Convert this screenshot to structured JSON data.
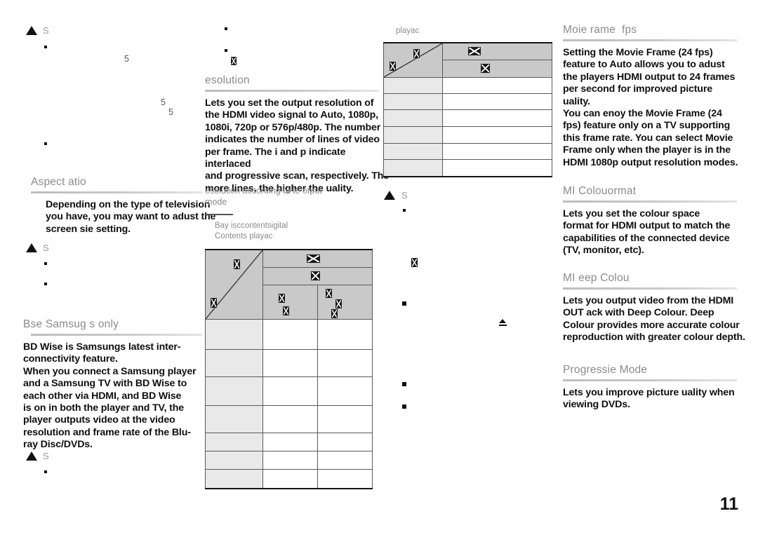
{
  "document": {
    "type": "product-manual-page",
    "page_number": "11",
    "note_label": "S",
    "missing_glyph": " "
  },
  "columns": {
    "col1": {
      "note_top": {
        "label": "S"
      },
      "stray_digits": [
        "5",
        "5",
        "5"
      ],
      "sections": [
        {
          "heading": "Aspect atio",
          "body": "Depending on the type of television\nyou have, you may want to adust the\nscreen sie setting.",
          "note_label": "S",
          "note_bullets": [
            "",
            ""
          ]
        },
        {
          "heading": "Bse Samsug s only",
          "body": "BD Wise is Samsungs latest inter-\nconnectivity feature.\nWhen you connect a Samsung player\nand a Samsung TV with BD Wise to\neach other via HDMI, and BD Wise\nis on in both the player and TV, the\nplayer outputs video at the video\nresolution and frame rate of the Blu-\nray Disc/DVDs.",
          "note_label": "S",
          "note_bullets": [
            ""
          ]
        }
      ]
    },
    "col2": {
      "sections": [
        {
          "heading": "esolution",
          "body": "Lets you set the output resolution of\nthe HDMI video signal to Auto, 1080p,\n1080i, 720p or 576p/480p. The number\nindicates the number of lines of video\nper frame. The i and p indicate interlaced\nand progressive scan, respectively. The\nmore lines, the higher the uality."
        }
      ],
      "subheading": "esolution according to te otput\nmode",
      "table_caption": "Bay isccontentsigital\nContents playac"
    },
    "col3": {
      "table_caption": "playac",
      "note_label": "S",
      "note_bullets": [
        "",
        "",
        ""
      ]
    },
    "col4": {
      "sections": [
        {
          "heading": "Moie rame  fps",
          "body": "Setting the Movie Frame (24 fps)\nfeature to Auto allows you to adust\nthe players HDMI output to 24 frames\nper second for improved picture\nuality.\nYou can enoy the Movie Frame (24\nfps) feature only on a TV supporting\nthis frame rate. You can select Movie\nFrame only when the player is in the\nHDMI 1080p output resolution modes."
        },
        {
          "heading": "MI Colouormat",
          "body": "Lets you set the colour space\nformat for HDMI output to match the\ncapabilities of the connected device\n(TV, monitor, etc)."
        },
        {
          "heading": "MI eep Colou",
          "body": "Lets you output video from the HDMI\nOUT ack with Deep Colour. Deep\nColour provides more accurate colour\nreproduction with greater colour depth."
        },
        {
          "heading": "Progressie Mode",
          "body": "Lets you improve picture uality when\nviewing DVDs."
        }
      ]
    }
  },
  "tables": {
    "resolution_table": {
      "id": "resolution-according-to-output-mode",
      "columns": 3,
      "header_rows": 3,
      "data_rows": 7,
      "corner_label_top": "",
      "corner_label_bottom": "",
      "header_band_1": "",
      "header_band_2": "",
      "header_cells": [
        "",
        ""
      ],
      "row_labels": [
        "",
        "",
        "",
        "",
        "",
        "",
        ""
      ],
      "cells": [
        [
          "",
          ""
        ],
        [
          "",
          ""
        ],
        [
          "",
          ""
        ],
        [
          "",
          ""
        ],
        [
          "",
          ""
        ],
        [
          "",
          ""
        ],
        [
          "",
          ""
        ]
      ]
    },
    "playback_table": {
      "id": "playback-table",
      "columns": 2,
      "header_rows": 2,
      "data_rows": 6,
      "corner_label_top": "",
      "corner_label_bottom": "",
      "header_band_1": "",
      "header_band_2": "",
      "row_labels": [
        "",
        "",
        "",
        "",
        "",
        ""
      ],
      "cells": [
        [
          ""
        ],
        [
          ""
        ],
        [
          ""
        ],
        [
          ""
        ],
        [
          ""
        ],
        [
          ""
        ]
      ]
    }
  },
  "colors": {
    "heading_grey": "#8b8b8b",
    "body_black": "#0f0f0f",
    "rule_grey": "#c9c9c9",
    "table_header_bg": "#c9c9c9",
    "table_rowlabel_bg": "#e9e9e9",
    "table_border": "#5a5a5a",
    "table_outer_border": "#141414"
  }
}
